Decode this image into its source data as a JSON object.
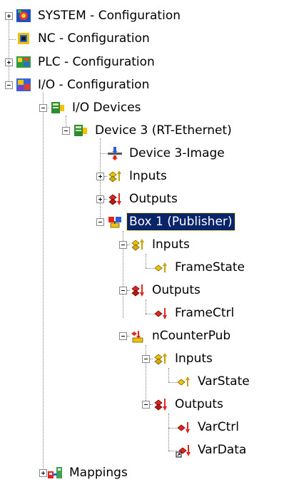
{
  "tree": {
    "system": {
      "label": "SYSTEM - Configuration",
      "icon": "system-gear-icon"
    },
    "nc": {
      "label": "NC - Configuration",
      "icon": "nc-config-icon"
    },
    "plc": {
      "label": "PLC - Configuration",
      "icon": "plc-config-icon"
    },
    "io": {
      "label": "I/O - Configuration",
      "icon": "io-config-icon"
    },
    "io_devices": {
      "label": "I/O Devices",
      "icon": "io-devices-icon"
    },
    "device3": {
      "label": "Device 3 (RT-Ethernet)",
      "icon": "ethernet-device-icon"
    },
    "device3_image": {
      "label": "Device 3-Image",
      "icon": "process-image-icon"
    },
    "dev_inputs": {
      "label": "Inputs",
      "icon": "inputs-icon"
    },
    "dev_outputs": {
      "label": "Outputs",
      "icon": "outputs-icon"
    },
    "box1": {
      "label": "Box 1 (Publisher)",
      "icon": "publisher-box-icon",
      "selected": true
    },
    "box_inputs": {
      "label": "Inputs",
      "icon": "inputs-icon"
    },
    "framestate": {
      "label": "FrameState",
      "icon": "input-variable-icon"
    },
    "box_outputs": {
      "label": "Outputs",
      "icon": "outputs-icon"
    },
    "framectrl": {
      "label": "FrameCtrl",
      "icon": "output-variable-icon"
    },
    "ncounterpub": {
      "label": "nCounterPub",
      "icon": "publisher-variable-icon"
    },
    "pub_inputs": {
      "label": "Inputs",
      "icon": "inputs-icon"
    },
    "varstate": {
      "label": "VarState",
      "icon": "input-variable-icon"
    },
    "pub_outputs": {
      "label": "Outputs",
      "icon": "outputs-icon"
    },
    "varctrl": {
      "label": "VarCtrl",
      "icon": "output-variable-icon"
    },
    "vardata": {
      "label": "VarData",
      "icon": "linked-output-variable-icon"
    },
    "mappings": {
      "label": "Mappings",
      "icon": "mappings-icon"
    }
  },
  "colors": {
    "selection": "#0a246a",
    "connector": "#7f7f7f"
  }
}
